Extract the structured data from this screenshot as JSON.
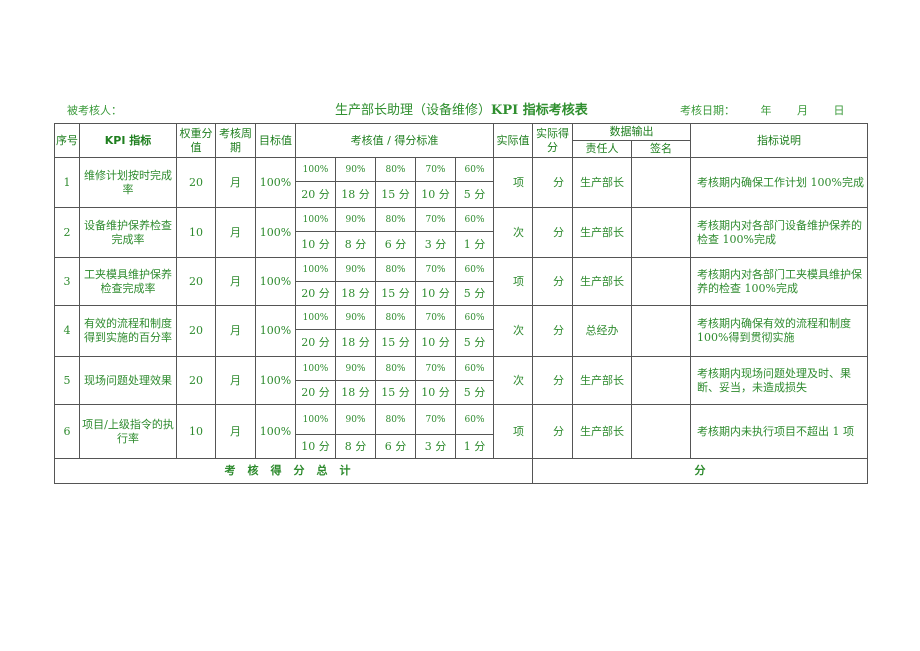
{
  "header": {
    "assessee_label": "被考核人：",
    "title_prefix": "生产部长助理（设备维修）",
    "title_kpi": "KPI",
    "title_suffix": " 指标考核表",
    "date_label": "考核日期：",
    "year": "年",
    "month": "月",
    "day": "日"
  },
  "columns": {
    "seq": "序号",
    "kpi": "KPI 指标",
    "weight": "权重分值",
    "period": "考核周期",
    "target": "目标值",
    "standard": "考核值 / 得分标准",
    "actual_value": "实际值",
    "actual_score": "实际得分",
    "data_output": "数据输出",
    "responsible": "责任人",
    "signature": "签名",
    "description": "指标说明"
  },
  "rows": [
    {
      "seq": "1",
      "kpi": "维修计划按时完成率",
      "weight": "20",
      "period": "月",
      "target": "100%",
      "levels": [
        "100%",
        "90%",
        "80%",
        "70%",
        "60%"
      ],
      "scores": [
        "20 分",
        "18 分",
        "15 分",
        "10 分",
        "5 分"
      ],
      "actual_unit": "项",
      "score_unit": "分",
      "responsible": "生产部长",
      "signature": "",
      "description": "考核期内确保工作计划 100%完成"
    },
    {
      "seq": "2",
      "kpi": "设备维护保养检查完成率",
      "weight": "10",
      "period": "月",
      "target": "100%",
      "levels": [
        "100%",
        "90%",
        "80%",
        "70%",
        "60%"
      ],
      "scores": [
        "10 分",
        "8 分",
        "6 分",
        "3 分",
        "1 分"
      ],
      "actual_unit": "次",
      "score_unit": "分",
      "responsible": "生产部长",
      "signature": "",
      "description": "考核期内对各部门设备维护保养的检查 100%完成"
    },
    {
      "seq": "3",
      "kpi": "工夹模具维护保养检查完成率",
      "weight": "20",
      "period": "月",
      "target": "100%",
      "levels": [
        "100%",
        "90%",
        "80%",
        "70%",
        "60%"
      ],
      "scores": [
        "20 分",
        "18 分",
        "15 分",
        "10 分",
        "5 分"
      ],
      "actual_unit": "项",
      "score_unit": "分",
      "responsible": "生产部长",
      "signature": "",
      "description": "考核期内对各部门工夹模具维护保养的检查 100%完成"
    },
    {
      "seq": "4",
      "kpi": "有效的流程和制度得到实施的百分率",
      "weight": "20",
      "period": "月",
      "target": "100%",
      "levels": [
        "100%",
        "90%",
        "80%",
        "70%",
        "60%"
      ],
      "scores": [
        "20 分",
        "18 分",
        "15 分",
        "10 分",
        "5 分"
      ],
      "actual_unit": "次",
      "score_unit": "分",
      "responsible": "总经办",
      "signature": "",
      "description": "考核期内确保有效的流程和制度 100%得到贯彻实施"
    },
    {
      "seq": "5",
      "kpi": "现场问题处理效果",
      "weight": "20",
      "period": "月",
      "target": "100%",
      "levels": [
        "100%",
        "90%",
        "80%",
        "70%",
        "60%"
      ],
      "scores": [
        "20 分",
        "18 分",
        "15 分",
        "10 分",
        "5 分"
      ],
      "actual_unit": "次",
      "score_unit": "分",
      "responsible": "生产部长",
      "signature": "",
      "description": "考核期内现场问题处理及时、果断、妥当，未造成损失"
    },
    {
      "seq": "6",
      "kpi": "项目/上级指令的执行率",
      "weight": "10",
      "period": "月",
      "target": "100%",
      "levels": [
        "100%",
        "90%",
        "80%",
        "70%",
        "60%"
      ],
      "scores": [
        "10 分",
        "8 分",
        "6 分",
        "3 分",
        "1 分"
      ],
      "actual_unit": "项",
      "score_unit": "分",
      "responsible": "生产部长",
      "signature": "",
      "description": "考核期内未执行项目不超出 1 项"
    }
  ],
  "footer": {
    "total_label": "考核得分总计",
    "total_unit": "分"
  }
}
